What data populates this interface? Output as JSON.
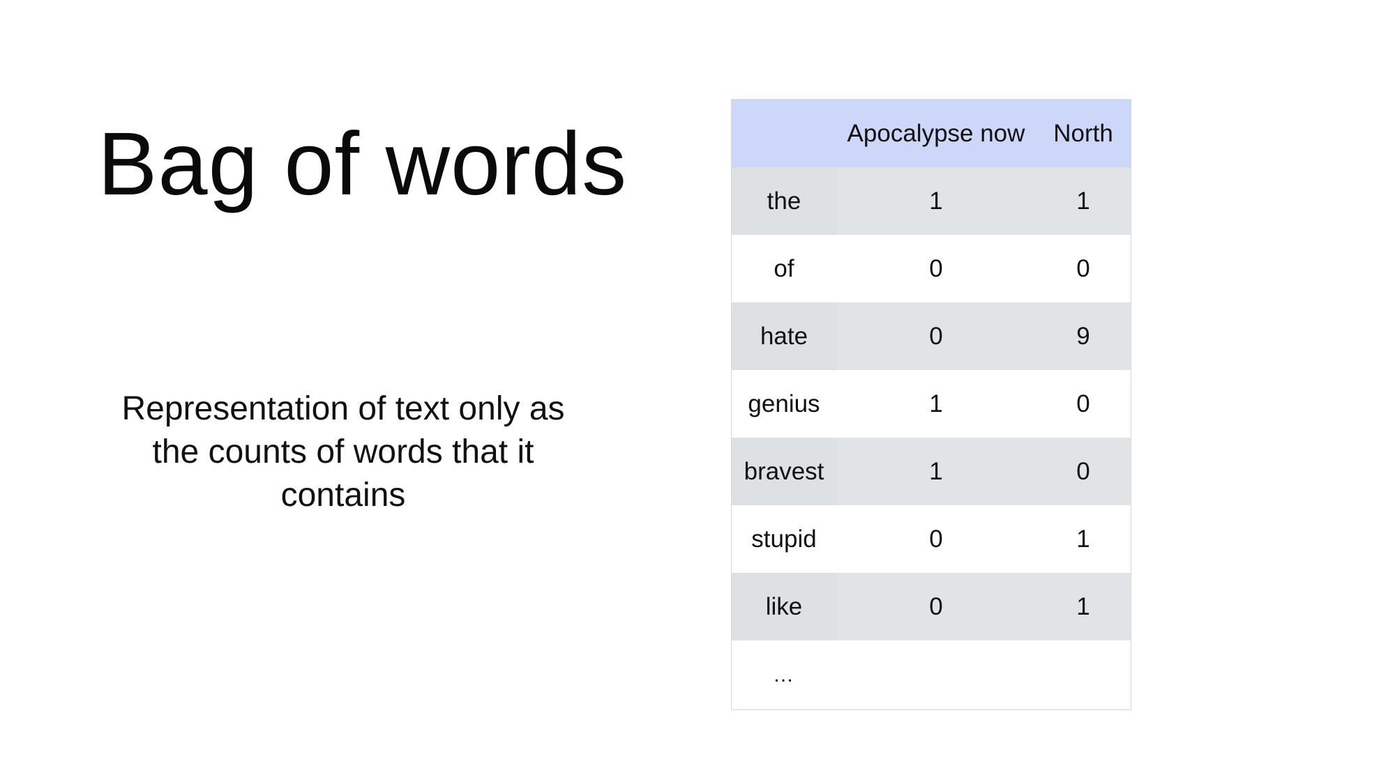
{
  "slide": {
    "title": "Bag of words",
    "body": "Representation of text only as the counts of words that it contains"
  },
  "table": {
    "columns": [
      "",
      "Apocalypse now",
      "North"
    ],
    "rows": [
      {
        "word": "the",
        "apocalypse_now": "1",
        "north": "1"
      },
      {
        "word": "of",
        "apocalypse_now": "0",
        "north": "0"
      },
      {
        "word": "hate",
        "apocalypse_now": "0",
        "north": "9"
      },
      {
        "word": "genius",
        "apocalypse_now": "1",
        "north": "0"
      },
      {
        "word": "bravest",
        "apocalypse_now": "1",
        "north": "0"
      },
      {
        "word": "stupid",
        "apocalypse_now": "0",
        "north": "1"
      },
      {
        "word": "like",
        "apocalypse_now": "0",
        "north": "1"
      }
    ],
    "ellipsis": "…"
  },
  "colors": {
    "header_background": "#ccd7fa",
    "striped_row_background": "#e1e4e7",
    "plain_row_background": "#ffffff"
  }
}
